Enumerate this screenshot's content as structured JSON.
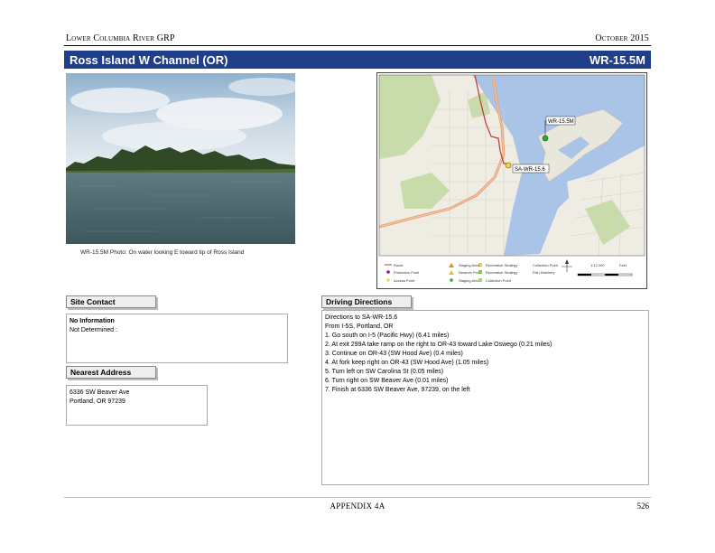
{
  "header": {
    "left": "Lower Columbia River GRP",
    "right": "October 2015"
  },
  "title_bar": {
    "site_name": "Ross Island W Channel (OR)",
    "site_code": "WR-15.5M"
  },
  "photo": {
    "caption": "WR-15.5M Photo: On water looking E toward tip of Ross Island"
  },
  "map": {
    "site_label": "WR-15.5M",
    "staging_label": "SA-WR-15.6",
    "legend": {
      "items": [
        "Route",
        "Protection Point",
        "Access Point",
        "Staging Area",
        "Reserve Point",
        "Staging Area",
        "Recreation Strategy",
        "Recreation Strategy",
        "Collection Point",
        "Collection Point",
        "Fish Hatchery"
      ],
      "scale_units": "Feet",
      "scale_note": "1:12,000",
      "colors": {
        "water": "#a9c4e6",
        "land": "#efece4",
        "park": "#c7dcaa",
        "route": "#c0392b",
        "highway": "#e8a074"
      }
    }
  },
  "site_contact": {
    "label": "Site Contact",
    "line1": "No Information",
    "line2": "Not Determined :"
  },
  "nearest_address": {
    "label": "Nearest Address",
    "line1": "6336 SW Beaver Ave",
    "line2": "Portland, OR 97239"
  },
  "driving_directions": {
    "label": "Driving Directions",
    "lines": [
      "Directions to SA-WR-15.6",
      "From I-5S, Portland, OR",
      "1. Go south on I-5 (Pacific Hwy) (6.41 miles)",
      "2. At exit 299A take ramp on the right to OR-43 toward Lake Oswego (0.21 miles)",
      "3. Continue on OR-43 (SW Hood Ave) (0.4 miles)",
      "4. At fork keep right on OR-43 (SW Hood Ave) (1.05 miles)",
      "5. Turn left on SW Carolina St (0.05 miles)",
      "6. Turn right on SW Beaver Ave (0.01 miles)",
      "7. Finish at 6336 SW Beaver Ave, 97239, on the left"
    ]
  },
  "footer": {
    "center": "APPENDIX 4A",
    "page": "526"
  }
}
